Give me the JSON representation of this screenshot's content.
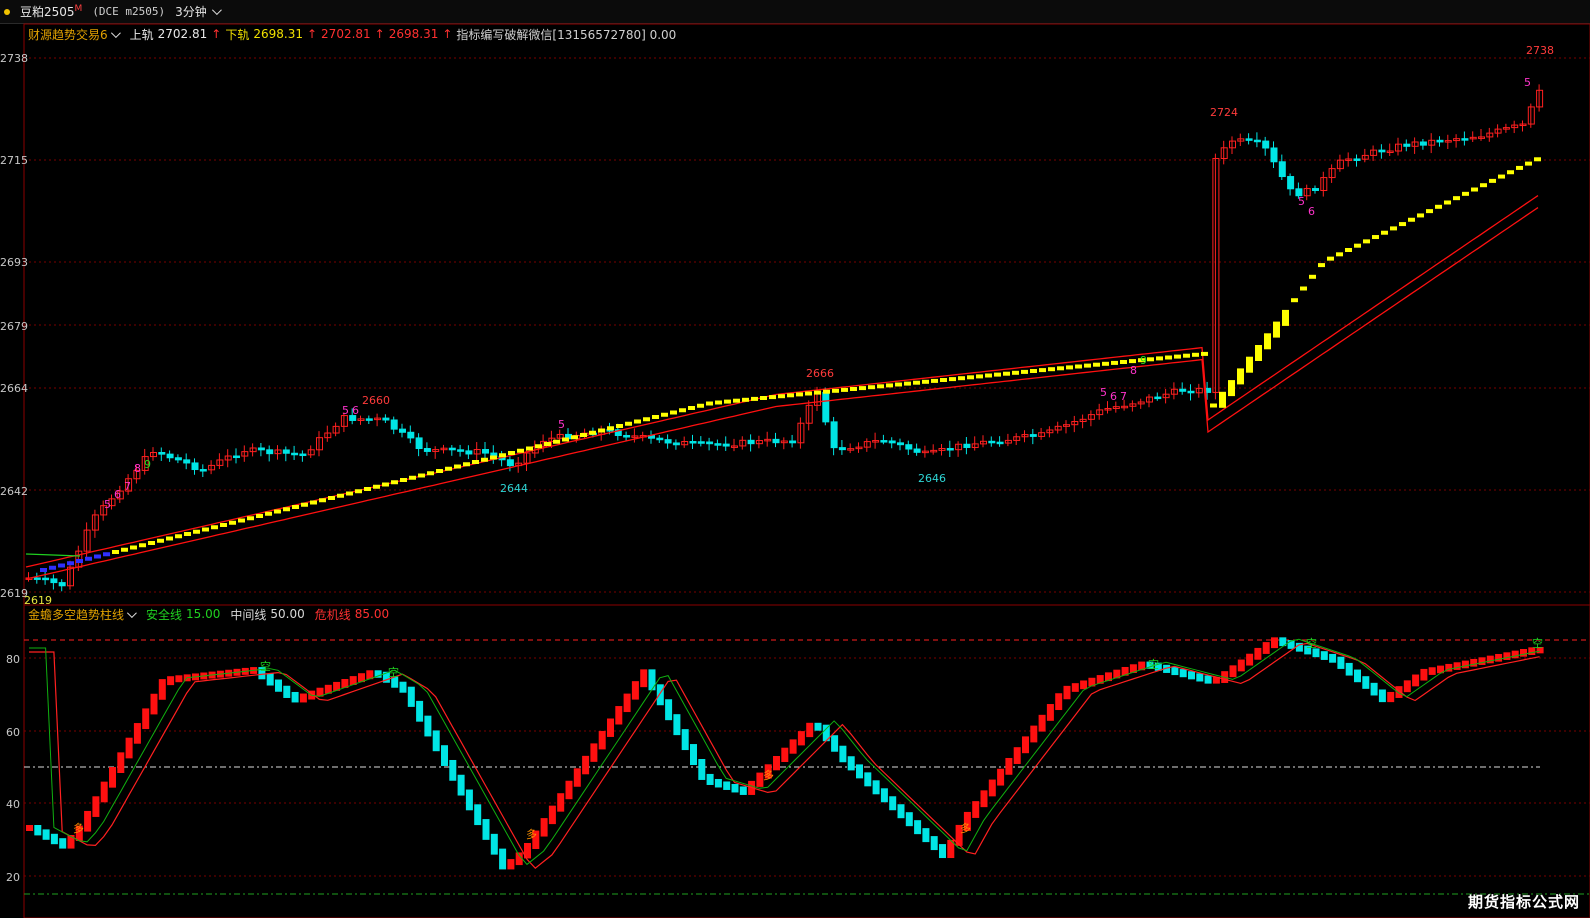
{
  "toolbar": {
    "symbol": "豆粕2505",
    "symbol_sup": "M",
    "code": "(DCE m2505)",
    "period": "3分钟"
  },
  "main_legend": {
    "name": "财源趋势交易6",
    "upper_label": "上轨",
    "upper_value": "2702.81",
    "lower_label": "下轨",
    "lower_value": "2698.31",
    "v3": "2702.81",
    "v4": "2698.31",
    "note": "指标编写破解微信[13156572780] 0.00"
  },
  "sub_legend": {
    "name": "金蟾多空趋势柱线",
    "safe_label": "安全线",
    "safe_value": "15.00",
    "mid_label": "中间线",
    "mid_value": "50.00",
    "danger_label": "危机线",
    "danger_value": "85.00"
  },
  "price_axis": [
    "2738",
    "2715",
    "2693",
    "2679",
    "2664",
    "2642",
    "2619"
  ],
  "osc_axis": [
    "80",
    "60",
    "40",
    "20"
  ],
  "annotations": {
    "high_2738": "2738",
    "high_2724": "2724",
    "high_2666": "2666",
    "high_2660": "2660",
    "low_2644": "2644",
    "low_2646": "2646",
    "low_2619": "2619"
  },
  "count_labels": {
    "a": "5",
    "b": "6",
    "c": "7",
    "d": "8",
    "e": "9"
  },
  "signal_label": "多",
  "signal_label_top": "空",
  "watermark": "期货指标公式网",
  "chart_data": {
    "type": "line",
    "price_panel": {
      "ylim": [
        2616,
        2742
      ],
      "ma_yellow_end": 2713,
      "red_band_end": [
        2700,
        2703
      ]
    },
    "oscillator_panel": {
      "ylim": [
        15,
        88
      ],
      "levels": [
        15,
        50,
        85
      ]
    }
  },
  "colors": {
    "up": "#ff2020",
    "down": "#00e5e5",
    "ma": "#ffff00",
    "band": "#ff1010",
    "grid": "#7a0000"
  }
}
